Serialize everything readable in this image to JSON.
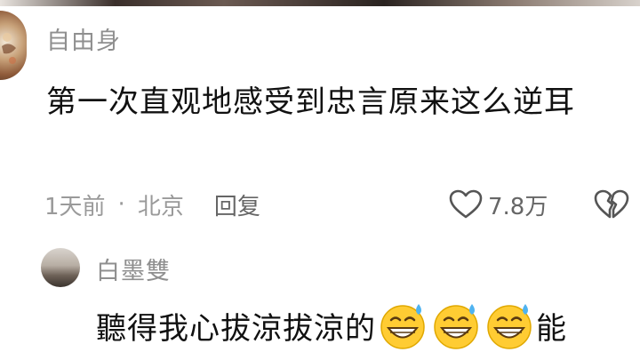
{
  "comment": {
    "username": "自由身",
    "text": "第一次直观地感受到忠言原来这么逆耳",
    "time": "1天前",
    "separator": "·",
    "location": "北京",
    "reply_label": "回复",
    "likes": "7.8万"
  },
  "reply": {
    "username": "白墨雙",
    "text_before": "聽得我心拔涼拔涼的",
    "emojis": [
      "grinning-sweat-emoji",
      "grinning-sweat-emoji",
      "grinning-sweat-emoji"
    ],
    "text_after": "能"
  },
  "icons": {
    "like": "heart-outline-icon",
    "dislike": "broken-heart-icon"
  }
}
